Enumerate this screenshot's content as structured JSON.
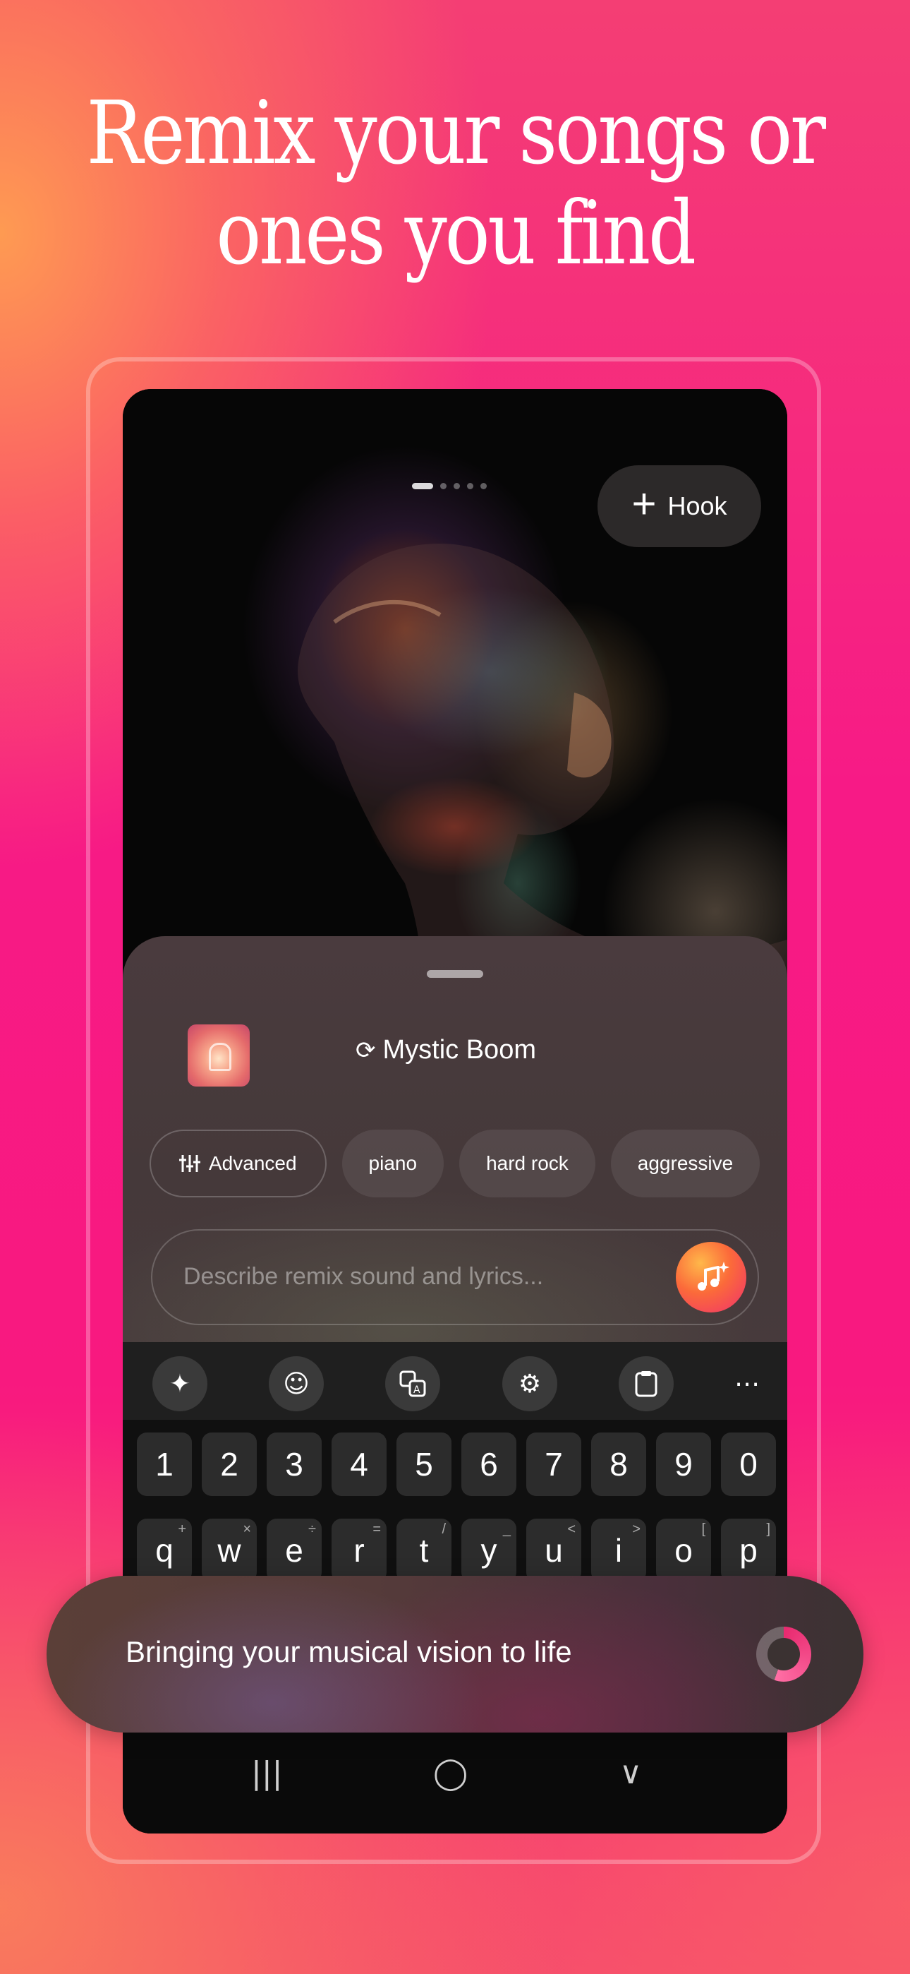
{
  "headline": {
    "line1": "Remix your songs or",
    "line2": "ones you find"
  },
  "hero": {
    "carousel_total": 5,
    "carousel_active": 1,
    "hook_button": {
      "icon": "plus-icon",
      "label": "Hook"
    }
  },
  "sheet": {
    "song": {
      "icon": "swap-icon",
      "title": "Mystic Boom"
    },
    "chips": [
      {
        "label": "Advanced",
        "icon": "sliders-icon"
      },
      {
        "label": "piano"
      },
      {
        "label": "hard rock"
      },
      {
        "label": "aggressive"
      }
    ],
    "prompt": {
      "placeholder": "Describe remix sound and lyrics...",
      "send_icon": "music-sparkle-icon"
    }
  },
  "keyboard": {
    "toolbar": [
      "sparkle-icon",
      "emoji-icon",
      "translate-icon",
      "gear-icon",
      "clipboard-icon",
      "more-icon"
    ],
    "number_row": [
      "1",
      "2",
      "3",
      "4",
      "5",
      "6",
      "7",
      "8",
      "9",
      "0"
    ],
    "letter_row": [
      {
        "key": "q",
        "sub": "+"
      },
      {
        "key": "w",
        "sub": "×"
      },
      {
        "key": "e",
        "sub": "÷"
      },
      {
        "key": "r",
        "sub": "="
      },
      {
        "key": "t",
        "sub": "/"
      },
      {
        "key": "y",
        "sub": "_"
      },
      {
        "key": "u",
        "sub": "<"
      },
      {
        "key": "i",
        "sub": ">"
      },
      {
        "key": "o",
        "sub": "["
      },
      {
        "key": "p",
        "sub": "]"
      }
    ]
  },
  "toast": {
    "text": "Bringing your musical vision to life",
    "icon": "loading-spinner-icon"
  },
  "navbar": {
    "recents": "|||",
    "home": "◯",
    "back": "∨"
  },
  "colors": {
    "accent_pink": "#f71a86",
    "accent_orange": "#fb6a3a"
  }
}
